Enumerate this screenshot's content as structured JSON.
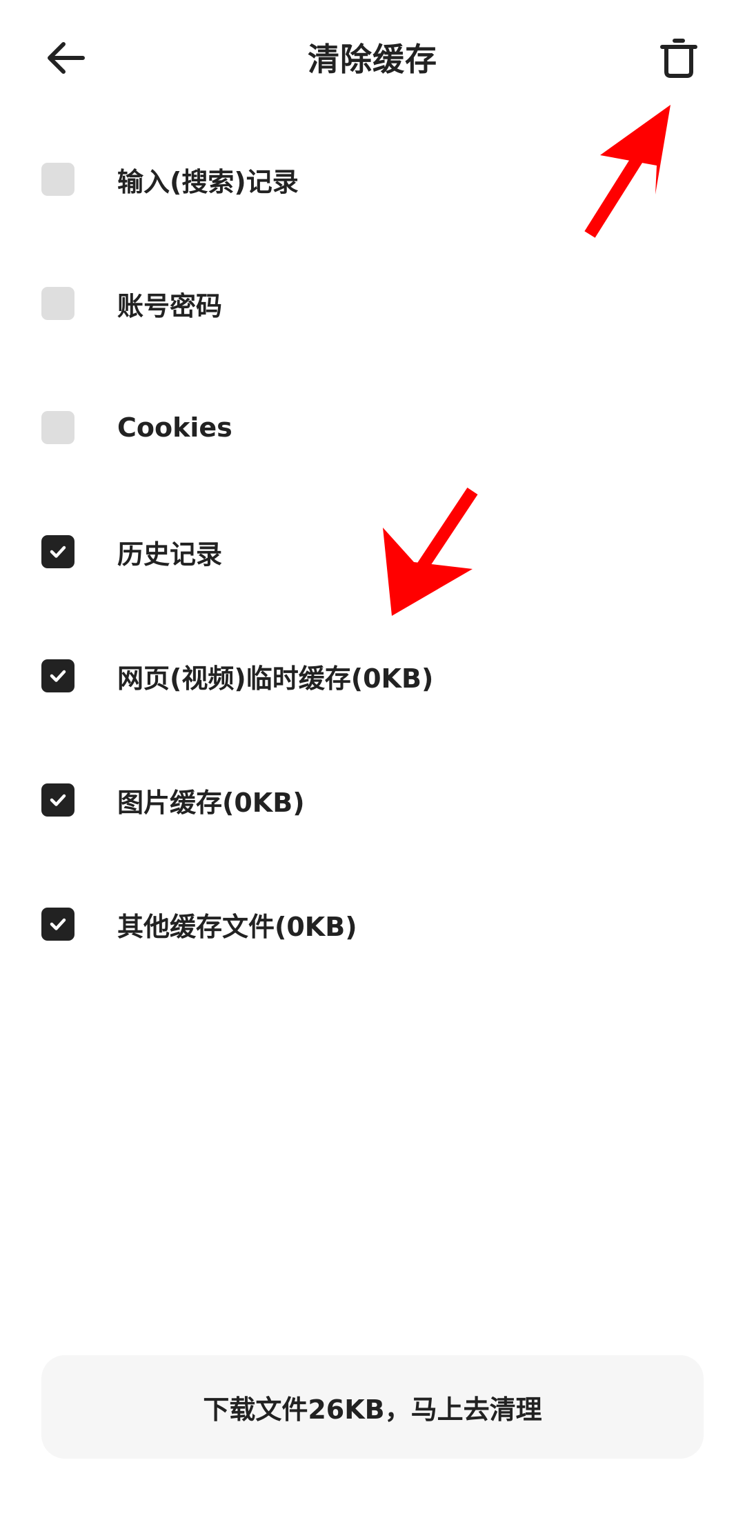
{
  "header": {
    "title": "清除缓存",
    "back_icon": "arrow-left-icon",
    "trash_icon": "trash-icon"
  },
  "options": [
    {
      "label": "输入(搜索)记录",
      "checked": false
    },
    {
      "label": "账号密码",
      "checked": false
    },
    {
      "label": "Cookies",
      "checked": false
    },
    {
      "label": "历史记录",
      "checked": true
    },
    {
      "label": "网页(视频)临时缓存(0KB)",
      "checked": true
    },
    {
      "label": "图片缓存(0KB)",
      "checked": true
    },
    {
      "label": "其他缓存文件(0KB)",
      "checked": true
    }
  ],
  "bottom_button": {
    "label": "下载文件26KB，马上去清理"
  },
  "colors": {
    "checkbox_checked": "#222222",
    "checkbox_unchecked": "#dedede",
    "annotation_arrow": "#ff0000",
    "button_bg": "#f6f6f6"
  }
}
